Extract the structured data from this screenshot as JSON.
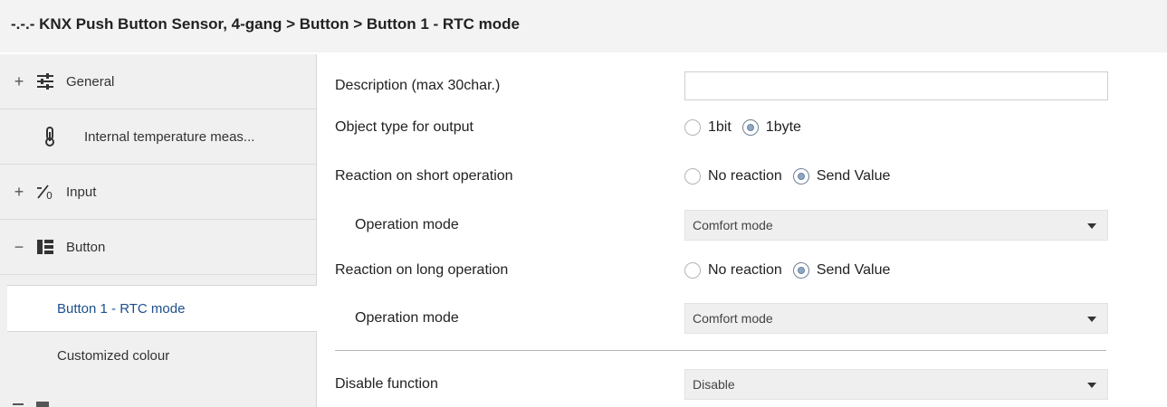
{
  "window": {
    "title": "-.-.- KNX Push Button Sensor, 4-gang > Button > Button 1 - RTC mode"
  },
  "sidebar": {
    "items": [
      {
        "toggle": "+",
        "icon": "sliders-icon",
        "label": "General"
      },
      {
        "toggle": "",
        "icon": "thermometer-icon",
        "label": "Internal temperature meas..."
      },
      {
        "toggle": "+",
        "icon": "input-icon",
        "label": "Input"
      },
      {
        "toggle": "−",
        "icon": "button-grid-icon",
        "label": "Button"
      }
    ],
    "subitems": [
      {
        "label": "Button 1 - RTC mode",
        "selected": true
      },
      {
        "label": "Customized colour",
        "selected": false
      }
    ]
  },
  "params": {
    "description": {
      "label": "Description (max 30char.)",
      "value": ""
    },
    "object_type": {
      "label": "Object type for output",
      "options": [
        "1bit",
        "1byte"
      ],
      "selected": "1byte"
    },
    "short_reaction": {
      "label": "Reaction on short operation",
      "options": [
        "No reaction",
        "Send Value"
      ],
      "selected": "Send Value"
    },
    "short_mode": {
      "label": "Operation mode",
      "value": "Comfort mode"
    },
    "long_reaction": {
      "label": "Reaction on long operation",
      "options": [
        "No reaction",
        "Send Value"
      ],
      "selected": "Send Value"
    },
    "long_mode": {
      "label": "Operation mode",
      "value": "Comfort mode"
    },
    "disable_function": {
      "label": "Disable function",
      "value": "Disable"
    }
  },
  "colors": {
    "selected_text": "#1d4f8c",
    "sidebar_bg": "#f0f0f0",
    "title_bg": "#f3f3f3"
  }
}
